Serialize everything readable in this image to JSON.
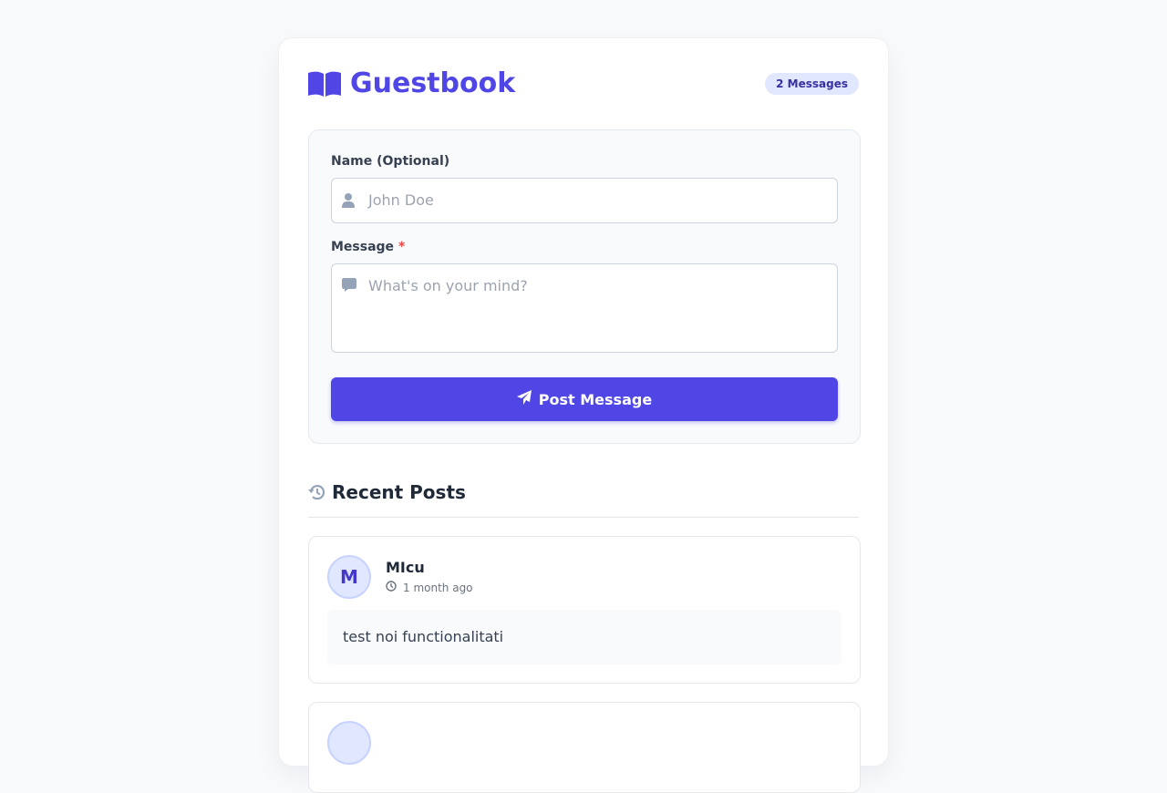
{
  "header": {
    "title": "Guestbook",
    "title_icon": "book-open-icon",
    "message_count": "2 Messages"
  },
  "form": {
    "name_label": "Name (Optional)",
    "name_placeholder": "John Doe",
    "name_icon": "user-icon",
    "message_label": "Message",
    "message_required_mark": "*",
    "message_placeholder": "What's on your mind?",
    "message_icon": "comment-icon",
    "submit_label": "Post Message",
    "submit_icon": "paper-plane-icon"
  },
  "recent": {
    "heading": "Recent Posts",
    "heading_icon": "history-icon"
  },
  "posts": [
    {
      "initial": "M",
      "author": "MIcu",
      "time": "1 month ago",
      "message": "test noi functionalitati"
    }
  ],
  "colors": {
    "accent": "#4f46e5",
    "badge_bg": "#e0e7ff",
    "required": "#ef4444"
  }
}
